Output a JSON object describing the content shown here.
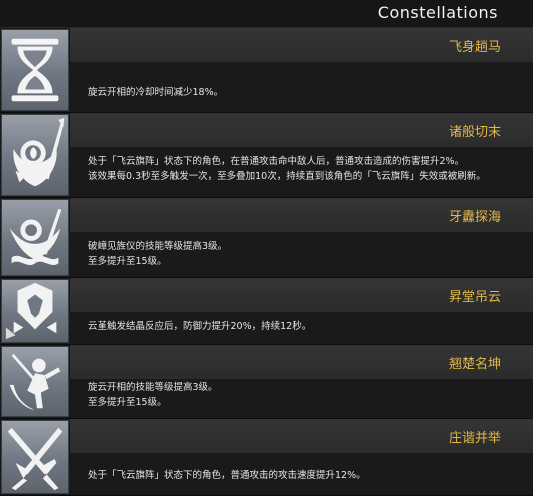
{
  "header": {
    "title": "Constellations"
  },
  "constellations": [
    {
      "name": "飞身趟马",
      "description": "旋云开相的冷却时间减少18%。",
      "icon": "hourglass-icon"
    },
    {
      "name": "诸般切末",
      "description": "处于「飞云旗阵」状态下的角色，在普通攻击命中敌人后，普通攻击造成的伤害提升2%。\n该效果每0.3秒至多触发一次，至多叠加10次，持续直到该角色的「飞云旗阵」失效或被刷新。",
      "icon": "spear-emblem-icon"
    },
    {
      "name": "牙纛探海",
      "description": "破嶂见旌仪的技能等级提高3级。\n至多提升至15级。",
      "icon": "banner-wave-icon"
    },
    {
      "name": "昇堂吊云",
      "description": "云堇触发结晶反应后，防御力提升20%，持续12秒。",
      "icon": "shield-crystal-icon"
    },
    {
      "name": "翘楚名坤",
      "description": "旋云开相的技能等级提高3级。\n至多提升至15级。",
      "icon": "dancer-icon"
    },
    {
      "name": "庄谐并举",
      "description": "处于「飞云旗阵」状态下的角色，普通攻击的攻击速度提升12%。",
      "icon": "crossed-swords-icon"
    }
  ]
}
